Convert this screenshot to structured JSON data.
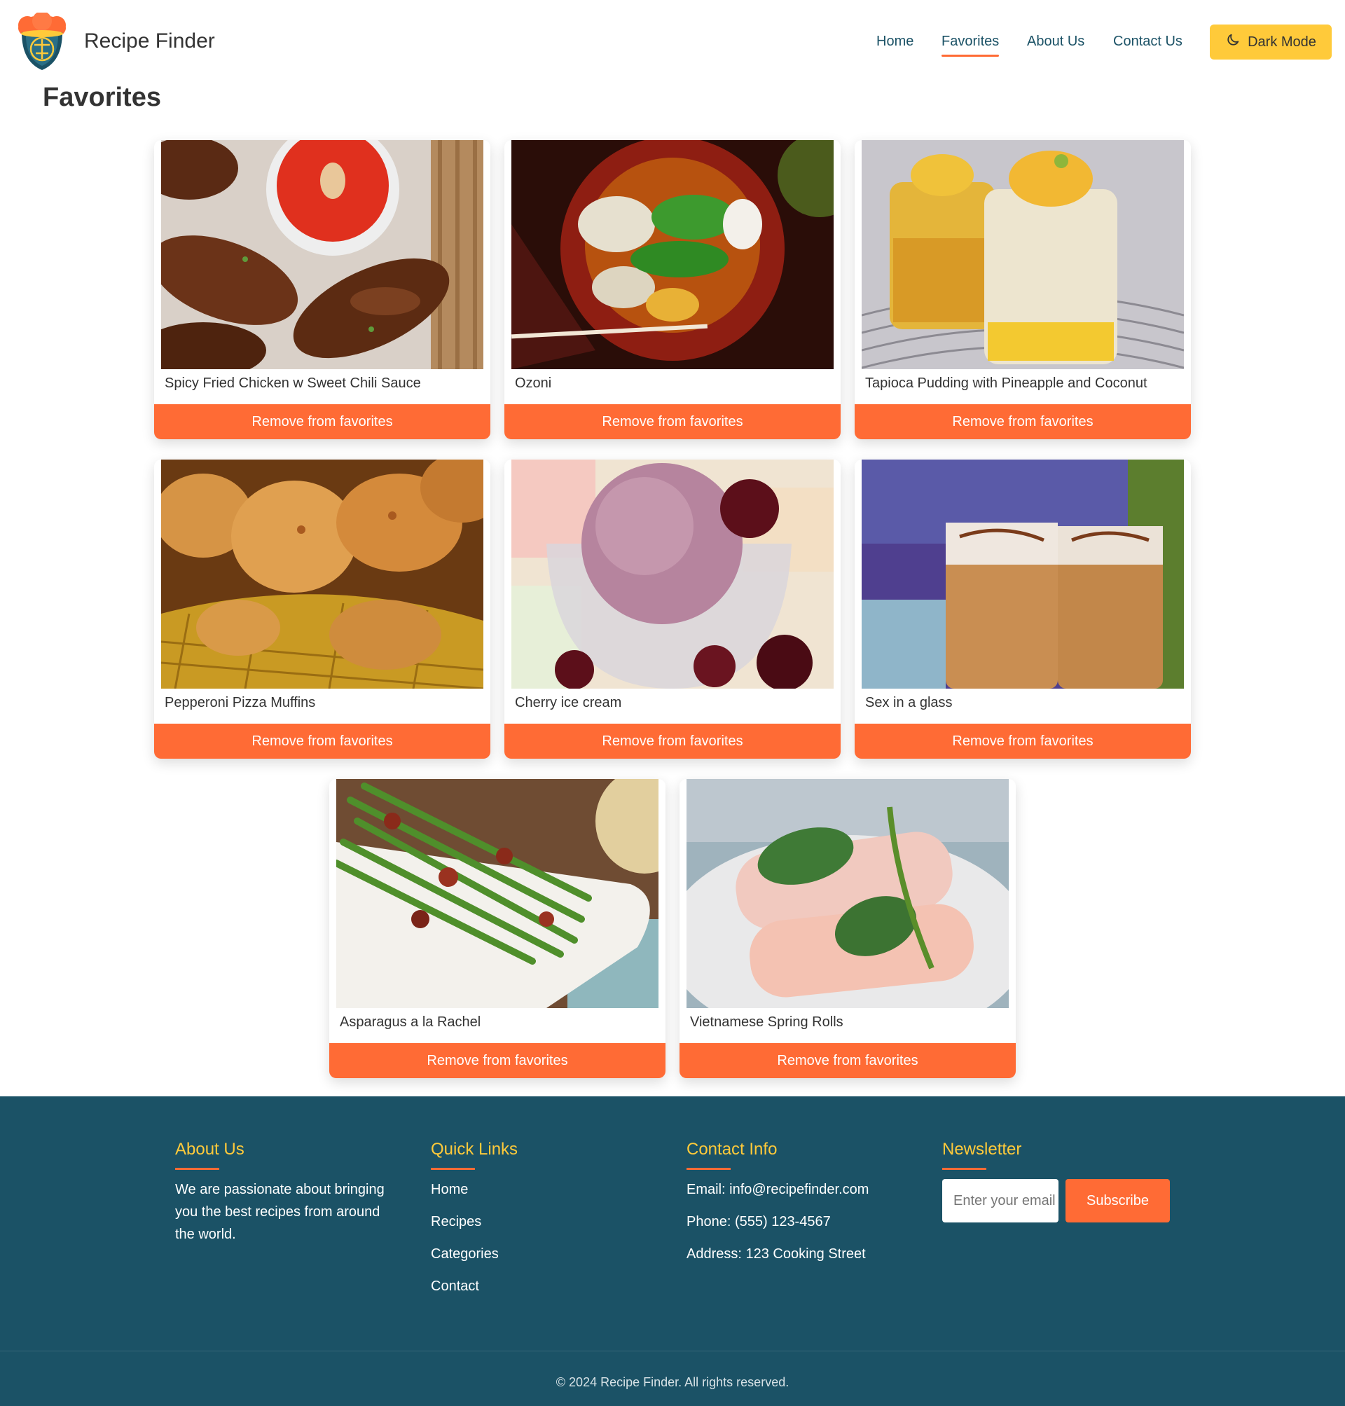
{
  "header": {
    "brand": "Recipe Finder",
    "nav": [
      "Home",
      "Favorites",
      "About Us",
      "Contact Us"
    ],
    "active_nav": "Favorites",
    "dark_mode_label": "Dark Mode"
  },
  "page": {
    "title": "Favorites"
  },
  "favorites": {
    "button_label": "Remove from favorites",
    "items": [
      {
        "title": "Spicy Fried Chicken w Sweet Chili Sauce"
      },
      {
        "title": "Ozoni"
      },
      {
        "title": "Tapioca Pudding with Pineapple and Coconut"
      },
      {
        "title": "Pepperoni Pizza Muffins"
      },
      {
        "title": "Cherry ice cream"
      },
      {
        "title": "Sex in a glass"
      },
      {
        "title": "Asparagus a la Rachel"
      },
      {
        "title": "Vietnamese Spring Rolls"
      }
    ]
  },
  "footer": {
    "about": {
      "heading": "About Us",
      "text": "We are passionate about bringing you the best recipes from around the world."
    },
    "quick_links": {
      "heading": "Quick Links",
      "links": [
        "Home",
        "Recipes",
        "Categories",
        "Contact"
      ]
    },
    "contact": {
      "heading": "Contact Info",
      "lines": [
        "Email: info@recipefinder.com",
        "Phone: (555) 123-4567",
        "Address: 123 Cooking Street"
      ]
    },
    "newsletter": {
      "heading": "Newsletter",
      "placeholder": "Enter your email",
      "button": "Subscribe"
    },
    "copyright": "© 2024 Recipe Finder. All rights reserved."
  },
  "colors": {
    "accent": "#ff6b35",
    "yellow": "#ffca3a",
    "footer_bg": "#1b5266"
  },
  "icons": {
    "dark_mode": "moon-icon",
    "logo": "chef-hat-logo-icon"
  }
}
